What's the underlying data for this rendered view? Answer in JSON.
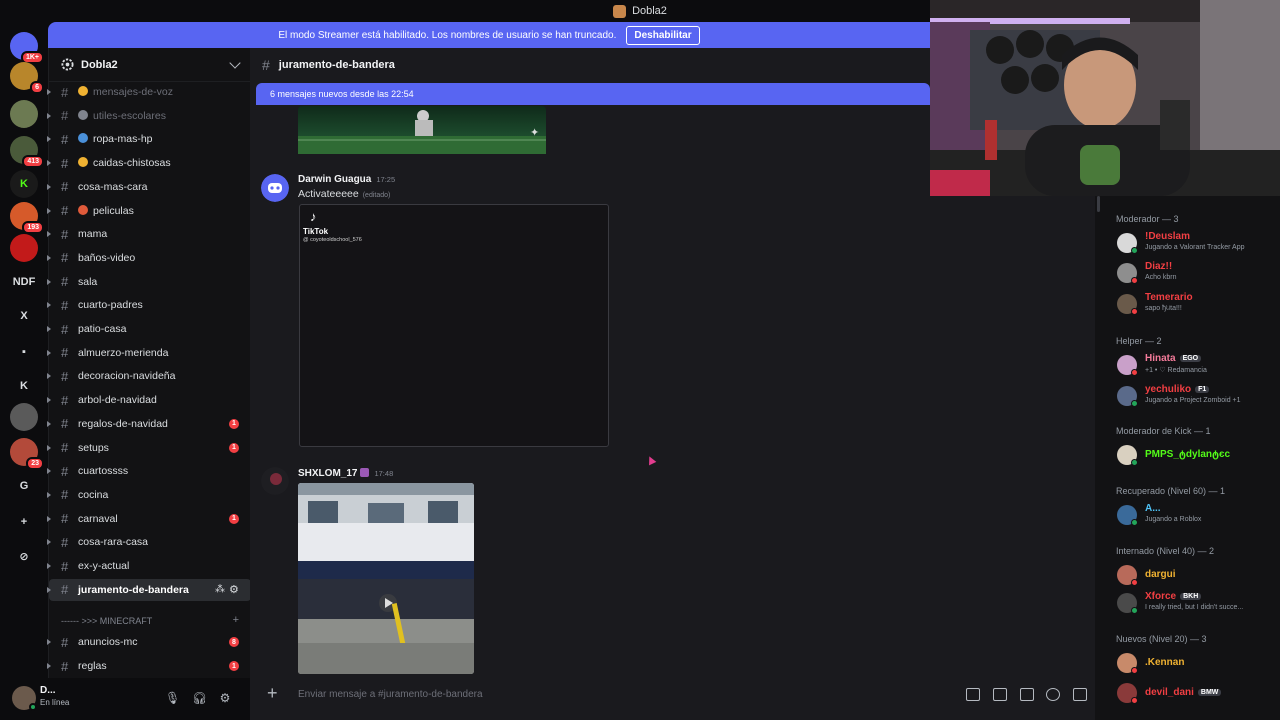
{
  "window": {
    "title": "Dobla2"
  },
  "banner": {
    "text": "El modo Streamer está habilitado. Los nombres de usuario se han truncado.",
    "button": "Deshabilitar"
  },
  "server_rail": [
    {
      "icon": "discord-icon",
      "badge": "1K+",
      "color": "#5865f2"
    },
    {
      "icon": "server-icon",
      "badge": "6",
      "color": "#b8862b"
    },
    {
      "icon": "server-icon",
      "badge": "",
      "color": "#6c7a52"
    },
    {
      "icon": "server-icon",
      "badge": "413",
      "color": "#4a5a3a"
    },
    {
      "icon": "k-icon",
      "badge": "",
      "color": "#1a1a1a",
      "text": "K",
      "textcolor": "#53fc18"
    },
    {
      "icon": "server-icon",
      "badge": "193",
      "color": "#d65a2a"
    },
    {
      "icon": "server-icon",
      "badge": "",
      "color": "#c21a1a"
    },
    {
      "icon": "text-icon",
      "badge": "",
      "color": "transparent",
      "text": "NDF"
    },
    {
      "icon": "x-icon",
      "badge": "",
      "color": "transparent",
      "text": "X"
    },
    {
      "icon": "folder-icon",
      "badge": "",
      "color": "transparent",
      "text": "▪"
    },
    {
      "icon": "k-icon",
      "badge": "",
      "color": "transparent",
      "text": "K"
    },
    {
      "icon": "server-icon",
      "badge": "",
      "color": "#5a5a5a"
    },
    {
      "icon": "server-icon",
      "badge": "23",
      "color": "#b34a3a"
    },
    {
      "icon": "g-icon",
      "badge": "",
      "color": "transparent",
      "text": "G"
    },
    {
      "icon": "add-server-icon",
      "badge": "",
      "color": "transparent",
      "text": "+"
    },
    {
      "icon": "explore-icon",
      "badge": "",
      "color": "transparent",
      "text": "⊘"
    }
  ],
  "sidebar": {
    "server_name": "Dobla2",
    "channels": [
      {
        "name": "mensajes-de-voz",
        "muted": true,
        "emoji": "#f0b232",
        "unread": ""
      },
      {
        "name": "utiles-escolares",
        "muted": true,
        "emoji": "#80848e",
        "unread": ""
      },
      {
        "name": "ropa-mas-hp",
        "muted": false,
        "emoji": "#4a90d9",
        "unread": ""
      },
      {
        "name": "caidas-chistosas",
        "muted": false,
        "emoji": "#f0b232",
        "unread": ""
      },
      {
        "name": "cosa-mas-cara",
        "muted": false,
        "emoji": "",
        "unread": ""
      },
      {
        "name": "peliculas",
        "muted": false,
        "emoji": "#e05a3a",
        "unread": ""
      },
      {
        "name": "mama",
        "muted": false,
        "emoji": "",
        "unread": ""
      },
      {
        "name": "baños-video",
        "muted": false,
        "emoji": "",
        "unread": ""
      },
      {
        "name": "sala",
        "muted": false,
        "emoji": "",
        "unread": ""
      },
      {
        "name": "cuarto-padres",
        "muted": false,
        "emoji": "",
        "unread": ""
      },
      {
        "name": "patio-casa",
        "muted": false,
        "emoji": "",
        "unread": ""
      },
      {
        "name": "almuerzo-merienda",
        "muted": false,
        "emoji": "",
        "unread": ""
      },
      {
        "name": "decoracion-navideña",
        "muted": false,
        "emoji": "",
        "unread": ""
      },
      {
        "name": "arbol-de-navidad",
        "muted": false,
        "emoji": "",
        "unread": ""
      },
      {
        "name": "regalos-de-navidad",
        "muted": false,
        "emoji": "",
        "unread": "1"
      },
      {
        "name": "setups",
        "muted": false,
        "emoji": "",
        "unread": "1"
      },
      {
        "name": "cuartossss",
        "muted": false,
        "emoji": "",
        "unread": ""
      },
      {
        "name": "cocina",
        "muted": false,
        "emoji": "",
        "unread": ""
      },
      {
        "name": "carnaval",
        "muted": false,
        "emoji": "",
        "unread": "1"
      },
      {
        "name": "cosa-rara-casa",
        "muted": false,
        "emoji": "",
        "unread": ""
      },
      {
        "name": "ex-y-actual",
        "muted": false,
        "emoji": "",
        "unread": ""
      },
      {
        "name": "juramento-de-bandera",
        "muted": false,
        "emoji": "",
        "unread": "",
        "selected": true
      }
    ],
    "category": "------ >>> MINECRAFT",
    "channels2": [
      {
        "name": "anuncios-mc",
        "unread": "8"
      },
      {
        "name": "reglas",
        "unread": "1"
      }
    ]
  },
  "user_panel": {
    "username": "D...",
    "status": "En línea"
  },
  "chat": {
    "channel": "juramento-de-bandera",
    "new_messages": "6 mensajes nuevos desde las 22:54",
    "messages": [
      {
        "author": "Darwin Guagua",
        "time": "17:25",
        "text": "Activateeeee",
        "edited": "(editado)",
        "tiktok_brand": "TikTok",
        "tiktok_handle": "@ coyoteoldschool_576"
      },
      {
        "author": "SHXLOM_17",
        "time": "17:48"
      }
    ],
    "composer_placeholder": "Enviar mensaje a #juramento-de-bandera"
  },
  "members": {
    "groups": [
      {
        "title": "Moderador — 3",
        "members": [
          {
            "name": "!Deuslam",
            "status": "Jugando a Valorant Tracker App",
            "color": "#f23f43",
            "av": "#d9d9d9",
            "dot": "#23a55a",
            "badge": ""
          },
          {
            "name": "Diaz!!",
            "status": "Acho kbrn",
            "color": "#f23f43",
            "av": "#8e8e8e",
            "dot": "#f23f43",
            "badge": ""
          },
          {
            "name": "Temerario",
            "status": "sapo ђ੫ta!!!",
            "color": "#f23f43",
            "av": "#6a5a4a",
            "dot": "#f23f43",
            "badge": ""
          }
        ]
      },
      {
        "title": "Helper — 2",
        "members": [
          {
            "name": "Hinata",
            "status": "+1 • ♡ Redamancia",
            "color": "#f47b9a",
            "av": "#c9a0c9",
            "dot": "#f23f43",
            "badge": "EGO"
          },
          {
            "name": "yechuliko",
            "status": "Jugando a Project Zomboid +1",
            "color": "#f23f43",
            "av": "#5a6a8a",
            "dot": "#23a55a",
            "badge": "F1"
          }
        ]
      },
      {
        "title": "Moderador de Kick — 1",
        "members": [
          {
            "name": "PMPS_ტdylanტєc",
            "status": "",
            "color": "#53fc18",
            "av": "#d9d0c0",
            "dot": "#23a55a",
            "badge": ""
          }
        ]
      },
      {
        "title": "Recuperado (Nivel 60) — 1",
        "members": [
          {
            "name": "A...",
            "status": "Jugando a Roblox",
            "color": "#4fc3f7",
            "av": "#3a6a9a",
            "dot": "#23a55a",
            "badge": ""
          }
        ]
      },
      {
        "title": "Internado (Nivel 40) — 2",
        "members": [
          {
            "name": "dargui",
            "status": "",
            "color": "#f0b232",
            "av": "#b86a5a",
            "dot": "#f23f43",
            "badge": ""
          },
          {
            "name": "Xforce",
            "status": "I really tried, but I didn't succe...",
            "color": "#f23f43",
            "av": "#4a4a4a",
            "dot": "#23a55a",
            "badge": "BKH"
          }
        ]
      },
      {
        "title": "Nuevos (Nivel 20) — 3",
        "members": [
          {
            "name": ".Kennan",
            "status": "",
            "color": "#f0b232",
            "av": "#c88a6a",
            "dot": "#f23f43",
            "badge": ""
          },
          {
            "name": "devil_dani",
            "status": "",
            "color": "#f23f43",
            "av": "#8a3a3a",
            "dot": "#f23f43",
            "badge": "BMW"
          }
        ]
      }
    ]
  }
}
